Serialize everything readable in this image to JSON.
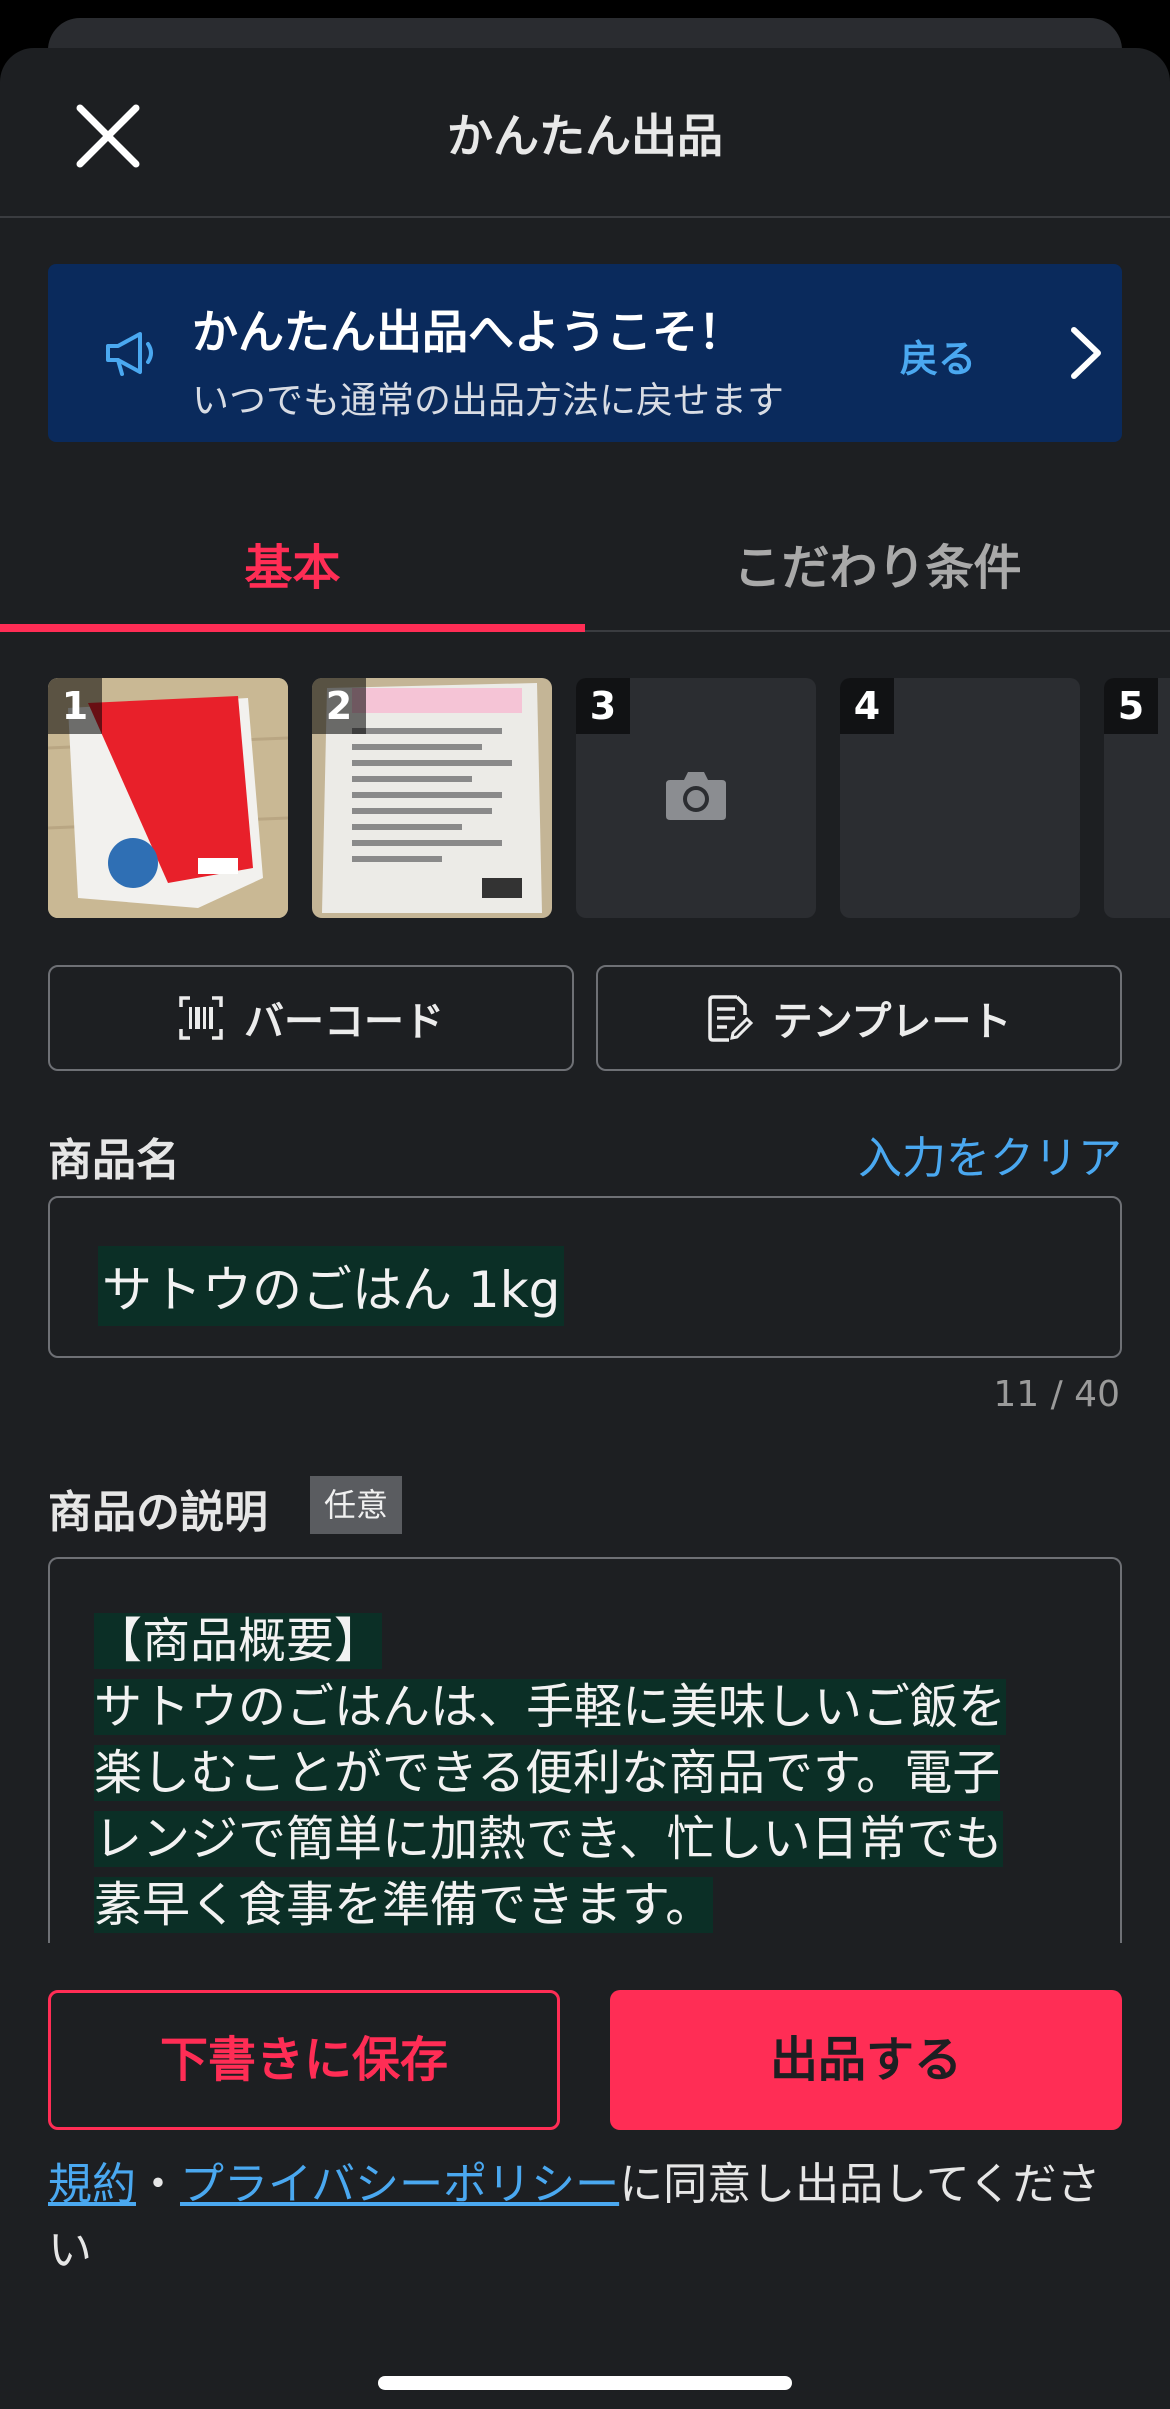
{
  "header": {
    "title": "かんたん出品",
    "close_icon": "close-icon"
  },
  "banner": {
    "title": "かんたん出品へようこそ！",
    "subtitle": "いつでも通常の出品方法に戻せます",
    "back_label": "戻る",
    "icon": "megaphone-icon"
  },
  "tabs": [
    {
      "label": "基本",
      "active": true
    },
    {
      "label": "こだわり条件",
      "active": false
    }
  ],
  "photos": [
    {
      "number": "1",
      "filled": true
    },
    {
      "number": "2",
      "filled": true
    },
    {
      "number": "3",
      "filled": false,
      "icon": "camera-icon"
    },
    {
      "number": "4",
      "filled": false
    },
    {
      "number": "5",
      "filled": false
    }
  ],
  "tools": {
    "barcode_label": "バーコード",
    "template_label": "テンプレート"
  },
  "product_name": {
    "label": "商品名",
    "clear_label": "入力をクリア",
    "value": "サトウのごはん 1kg",
    "counter": "11 / 40"
  },
  "description": {
    "label": "商品の説明",
    "badge": "任意",
    "lines": [
      "【商品概要】",
      "サトウのごはんは、手軽に美味しいご飯を",
      "楽しむことができる便利な商品です。電子",
      "レンジで簡単に加熱でき、忙しい日常でも",
      "素早く食事を準備できます。"
    ]
  },
  "actions": {
    "draft_label": "下書きに保存",
    "submit_label": "出品する"
  },
  "agreement": {
    "terms_link": "規約",
    "separator": "・",
    "privacy_link": "プライバシーポリシー",
    "suffix": "に同意し出品してください"
  },
  "colors": {
    "accent": "#ff2d55",
    "link": "#4aa8f0",
    "banner_bg": "#0a2a5c",
    "background": "#1d1f22"
  }
}
